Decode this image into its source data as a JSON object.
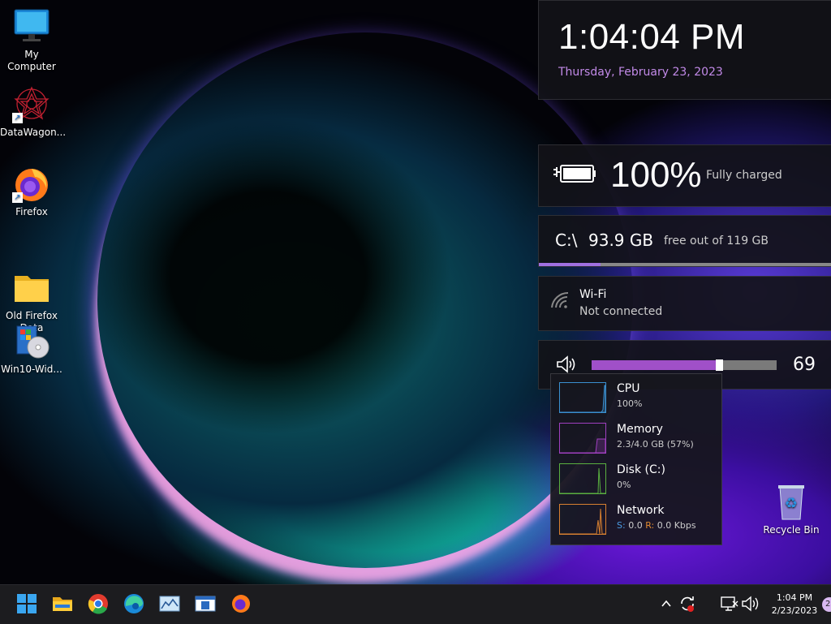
{
  "desktop": {
    "icons": [
      {
        "label": "My Computer"
      },
      {
        "label": "DataWagon..."
      },
      {
        "label": "Firefox"
      },
      {
        "label": "Old Firefox\nData"
      },
      {
        "label": "Win10-Wid..."
      },
      {
        "label": "Recycle Bin"
      }
    ]
  },
  "clock": {
    "time": "1:04:04 PM",
    "date": "Thursday, February 23, 2023"
  },
  "battery": {
    "percent": "100%",
    "status": "Fully charged"
  },
  "disk": {
    "drive": "C:\\",
    "free": "93.9 GB",
    "total": "free out of 119 GB",
    "used_fraction": 0.21
  },
  "wifi": {
    "title": "Wi-Fi",
    "status": "Not connected"
  },
  "volume": {
    "value": "69",
    "level": 0.69
  },
  "perf": {
    "cpu": {
      "name": "CPU",
      "value": "100%",
      "color": "#3a8fd0"
    },
    "memory": {
      "name": "Memory",
      "value": "2.3/4.0 GB (57%)",
      "color": "#a040c0"
    },
    "disk": {
      "name": "Disk (C:)",
      "value": "0%",
      "color": "#5ab040"
    },
    "network": {
      "name": "Network",
      "send_label": "S:",
      "send_value": "0.0",
      "recv_label": "R:",
      "recv_value": "0.0 Kbps",
      "color": "#d88030"
    }
  },
  "taskbar": {
    "time": "1:04 PM",
    "date": "2/23/2023",
    "notification_count": "2"
  },
  "colors": {
    "accent": "#a050c8",
    "date_text": "#c28ae8"
  }
}
